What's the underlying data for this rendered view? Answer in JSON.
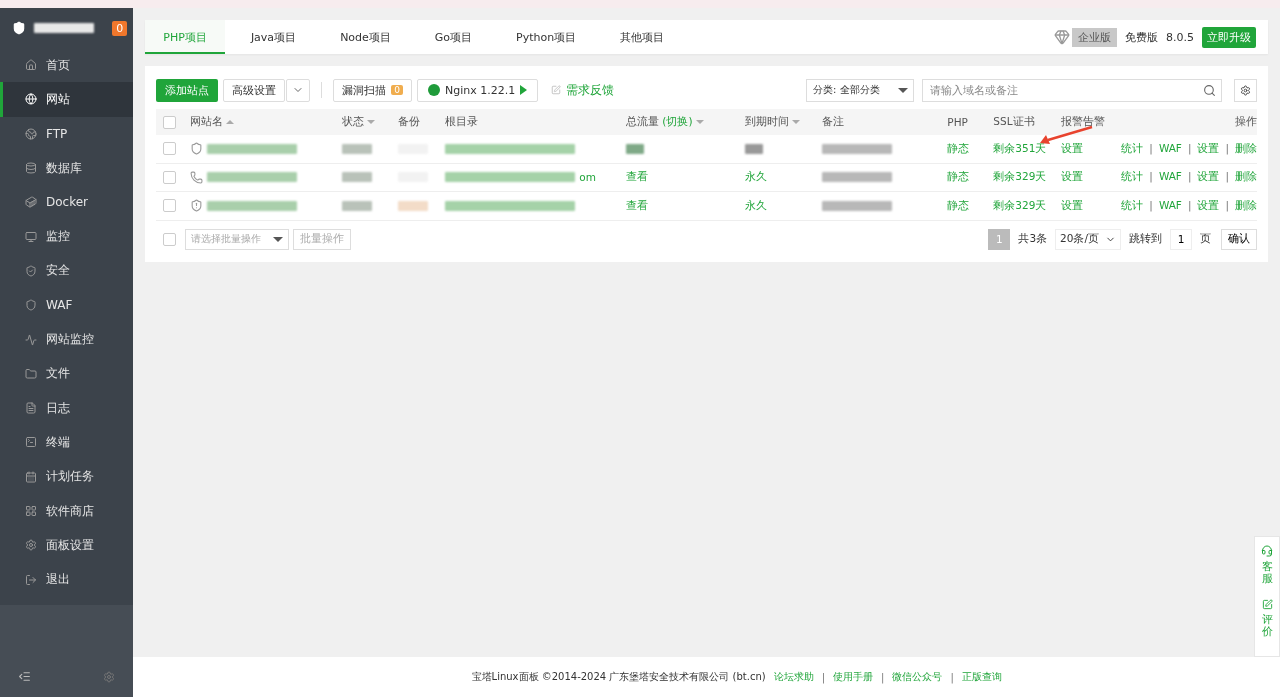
{
  "sidebar": {
    "badge": "0",
    "items": [
      {
        "label": "首页",
        "selected": false
      },
      {
        "label": "网站",
        "selected": true
      },
      {
        "label": "FTP",
        "selected": false
      },
      {
        "label": "数据库",
        "selected": false
      },
      {
        "label": "Docker",
        "selected": false
      },
      {
        "label": "监控",
        "selected": false
      },
      {
        "label": "安全",
        "selected": false
      },
      {
        "label": "WAF",
        "selected": false
      },
      {
        "label": "网站监控",
        "selected": false
      },
      {
        "label": "文件",
        "selected": false
      },
      {
        "label": "日志",
        "selected": false
      },
      {
        "label": "终端",
        "selected": false
      },
      {
        "label": "计划任务",
        "selected": false
      },
      {
        "label": "软件商店",
        "selected": false
      },
      {
        "label": "面板设置",
        "selected": false
      },
      {
        "label": "退出",
        "selected": false
      }
    ]
  },
  "tabs": [
    {
      "label": "PHP项目",
      "selected": true
    },
    {
      "label": "Java项目",
      "selected": false
    },
    {
      "label": "Node项目",
      "selected": false
    },
    {
      "label": "Go项目",
      "selected": false
    },
    {
      "label": "Python项目",
      "selected": false
    },
    {
      "label": "其他项目",
      "selected": false
    }
  ],
  "edition": {
    "enterprise": "企业版",
    "free": "免费版",
    "version": "8.0.5",
    "upgrade": "立即升级"
  },
  "toolbar": {
    "add": "添加站点",
    "advanced": "高级设置",
    "scan": "漏洞扫描",
    "scan_count": "0",
    "nginx": "Nginx 1.22.1",
    "feedback": "需求反馈",
    "category": "分类: 全部分类",
    "search_placeholder": "请输入域名或备注"
  },
  "table": {
    "all_checked": false,
    "separator": "|",
    "columns": [
      {
        "label": "网站名",
        "kind": "ascending"
      },
      {
        "label": "状态",
        "kind": "descending"
      },
      {
        "label": "备份",
        "kind": "plain"
      },
      {
        "label": "根目录",
        "kind": "plain"
      },
      {
        "label": "总流量",
        "switch": "(切换)",
        "kind": "descending"
      },
      {
        "label": "到期时间",
        "kind": "descending"
      },
      {
        "label": "备注",
        "kind": "plain"
      },
      {
        "label": "PHP",
        "kind": "plain"
      },
      {
        "label": "SSL证书",
        "kind": "plain"
      },
      {
        "label": "报警告警",
        "kind": "plain"
      },
      {
        "label": "操作",
        "kind": "plain"
      }
    ],
    "rows": [
      {
        "checked": false,
        "php": "静态",
        "ssl": "剩余351天",
        "alarm": "设置",
        "actions": [
          "统计",
          "WAF",
          "设置",
          "删除"
        ]
      },
      {
        "checked": false,
        "root_tail": "om",
        "traffic": "查看",
        "expiry": "永久",
        "php": "静态",
        "ssl": "剩余329天",
        "alarm": "设置",
        "actions": [
          "统计",
          "WAF",
          "设置",
          "删除"
        ]
      },
      {
        "checked": false,
        "traffic": "查看",
        "expiry": "永久",
        "php": "静态",
        "ssl": "剩余329天",
        "alarm": "设置",
        "actions": [
          "统计",
          "WAF",
          "设置",
          "删除"
        ]
      }
    ]
  },
  "batch": {
    "checked": false,
    "placeholder": "请选择批量操作",
    "button": "批量操作"
  },
  "pagination": {
    "current": "1",
    "total": "共3条",
    "page_size": "20条/页",
    "jump": "跳转到",
    "jump_value": "1",
    "page": "页",
    "confirm": "确认"
  },
  "footer": {
    "text": "宝塔Linux面板 ©2014-2024 广东堡塔安全技术有限公司 (bt.cn)",
    "separator": "|",
    "links": [
      "论坛求助",
      "使用手册",
      "微信公众号",
      "正版查询"
    ]
  },
  "float": {
    "service": "客服",
    "rate": "评价"
  }
}
